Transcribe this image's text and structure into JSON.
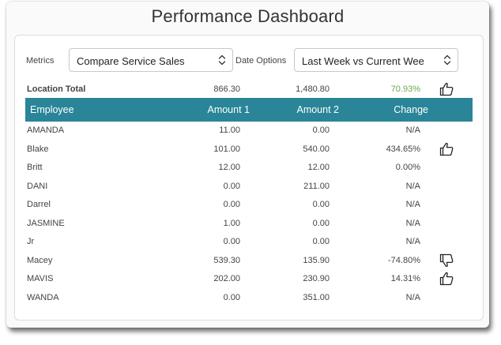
{
  "page": {
    "title": "Performance Dashboard"
  },
  "filters": {
    "metrics_label": "Metrics",
    "metrics_value": "Compare Service Sales",
    "date_label": "Date Options",
    "date_value": "Last Week vs Current Wee"
  },
  "total": {
    "label": "Location Total",
    "amount1": "866.30",
    "amount2": "1,480.80",
    "change": "70.93%",
    "trend": "up",
    "change_color": "#6aa84f"
  },
  "table": {
    "headers": {
      "employee": "Employee",
      "amount1": "Amount 1",
      "amount2": "Amount 2",
      "change": "Change"
    },
    "header_color": "#2a8598",
    "rows": [
      {
        "name": "AMANDA",
        "amount1": "11.00",
        "amount2": "0.00",
        "change": "N/A",
        "trend": ""
      },
      {
        "name": "Blake",
        "amount1": "101.00",
        "amount2": "540.00",
        "change": "434.65%",
        "trend": "up"
      },
      {
        "name": "Britt",
        "amount1": "12.00",
        "amount2": "12.00",
        "change": "0.00%",
        "trend": ""
      },
      {
        "name": "DANI",
        "amount1": "0.00",
        "amount2": "211.00",
        "change": "N/A",
        "trend": ""
      },
      {
        "name": "Darrel",
        "amount1": "0.00",
        "amount2": "0.00",
        "change": "N/A",
        "trend": ""
      },
      {
        "name": "JASMINE",
        "amount1": "1.00",
        "amount2": "0.00",
        "change": "N/A",
        "trend": ""
      },
      {
        "name": "Jr",
        "amount1": "0.00",
        "amount2": "0.00",
        "change": "N/A",
        "trend": ""
      },
      {
        "name": "Macey",
        "amount1": "539.30",
        "amount2": "135.90",
        "change": "-74.80%",
        "trend": "down"
      },
      {
        "name": "MAVIS",
        "amount1": "202.00",
        "amount2": "230.90",
        "change": "14.31%",
        "trend": "up"
      },
      {
        "name": "WANDA",
        "amount1": "0.00",
        "amount2": "351.00",
        "change": "N/A",
        "trend": ""
      }
    ]
  },
  "icons": {
    "up": "thumbs-up-icon",
    "down": "thumbs-down-icon",
    "chevron": "chevron-up-down-icon"
  }
}
